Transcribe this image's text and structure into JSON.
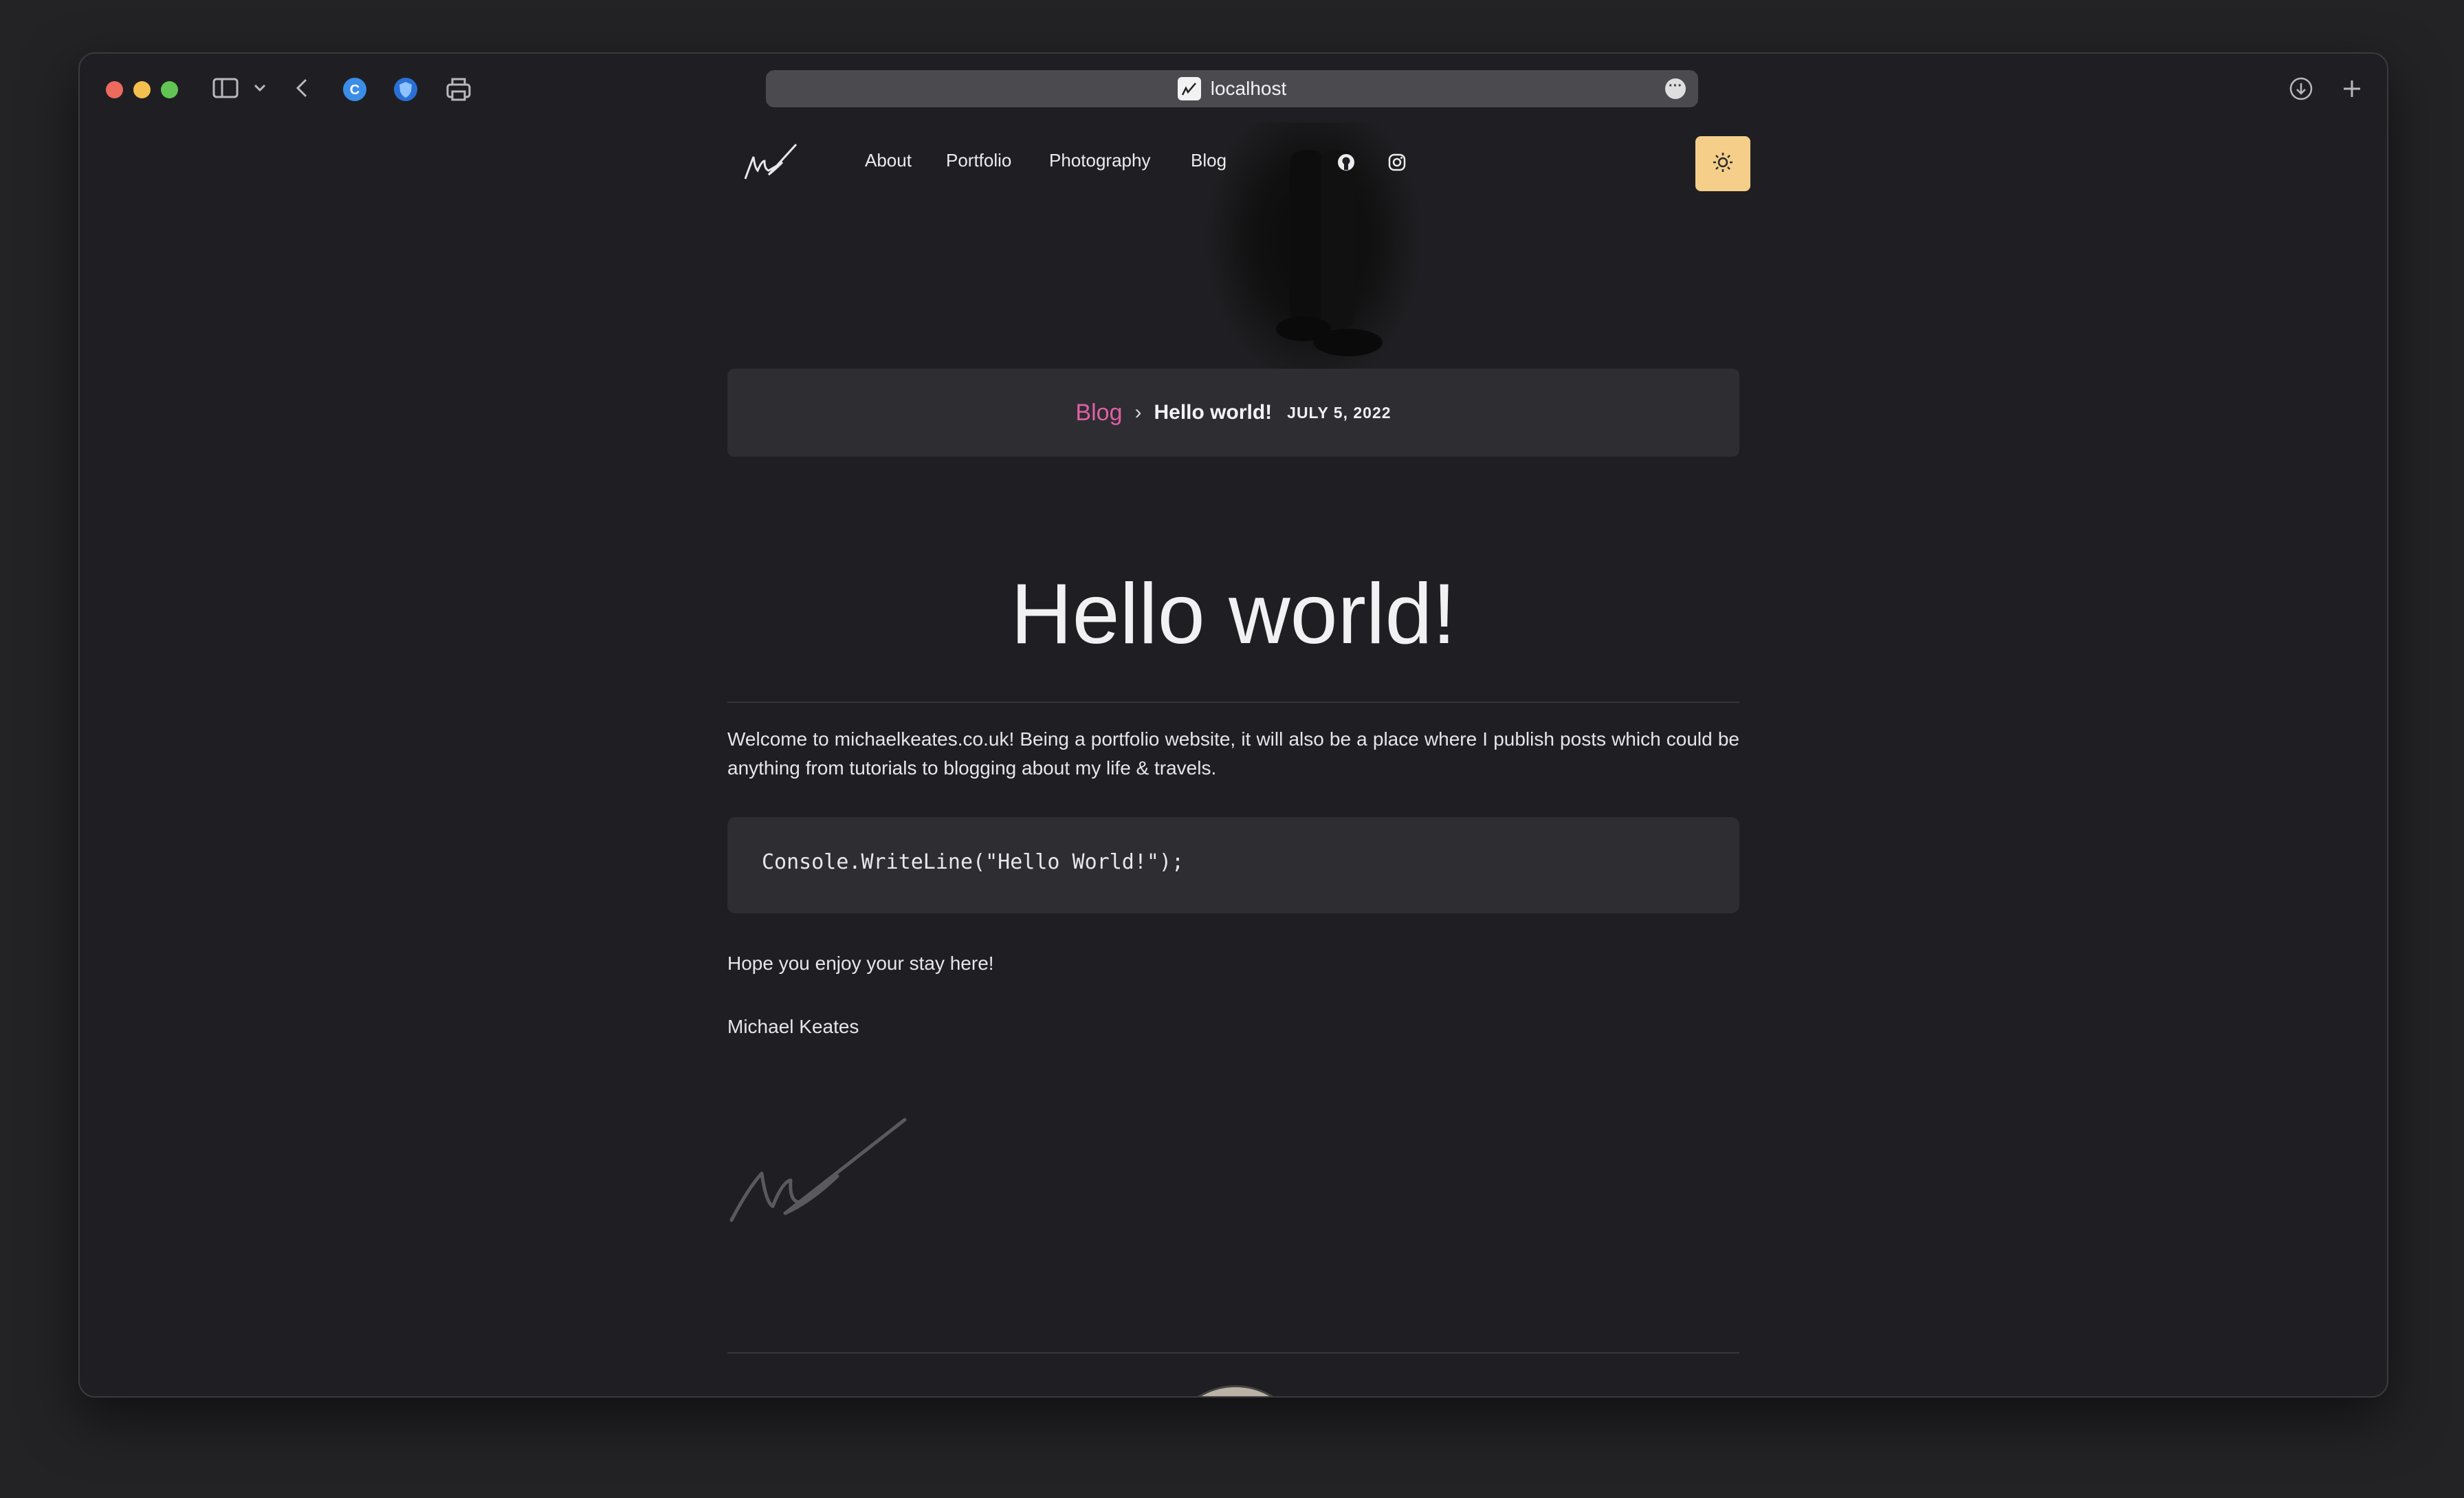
{
  "browser": {
    "url": "localhost"
  },
  "nav": {
    "links": [
      "About",
      "Portfolio",
      "Photography",
      "Blog"
    ],
    "github_icon": "github-icon",
    "instagram_icon": "instagram-icon",
    "theme_icon": "sun-icon"
  },
  "breadcrumb": {
    "parent": "Blog",
    "separator": "›",
    "current": "Hello world!",
    "date": "JULY 5, 2022"
  },
  "post": {
    "title": "Hello world!",
    "intro": "Welcome to michaelkeates.co.uk! Being a portfolio website, it will also be a place where I publish posts which could be anything from tutorials to blogging about my life & travels.",
    "code": "Console.WriteLine(\"Hello World!\");",
    "closing": "Hope you enjoy your stay here!",
    "author": "Michael Keates"
  },
  "colors": {
    "accent_link": "#e05fa5",
    "theme_button": "#f5cf8a",
    "background": "#1f1f23",
    "card": "#2d2d32"
  }
}
